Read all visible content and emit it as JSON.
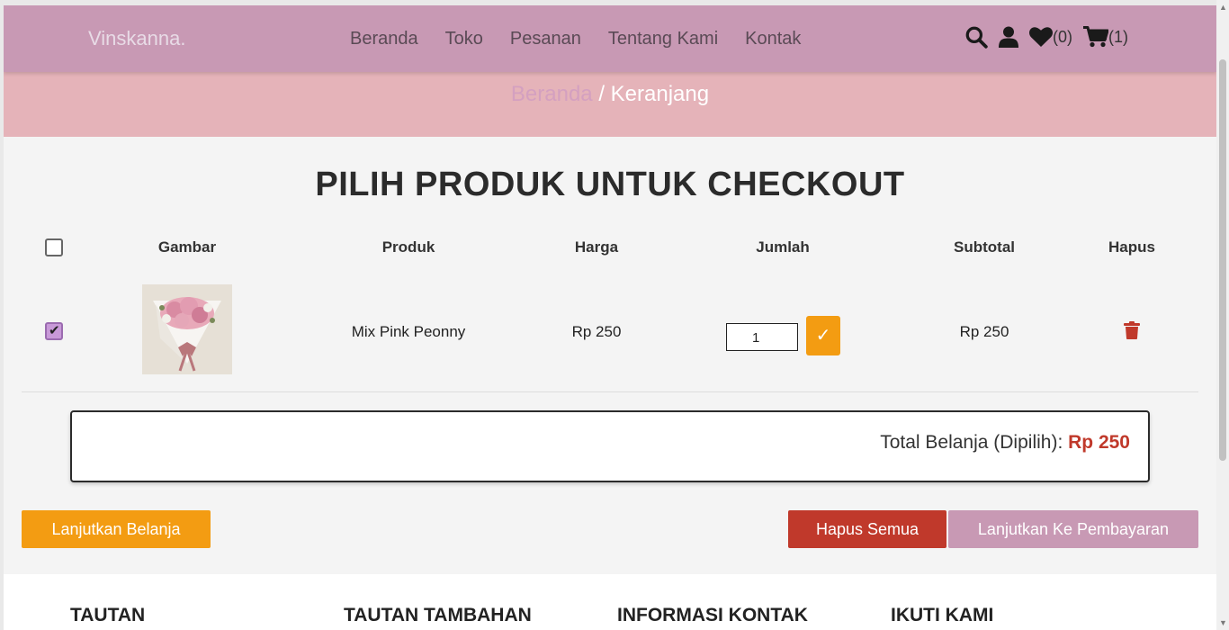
{
  "header": {
    "logo": "Vinskanna.",
    "nav": [
      "Beranda",
      "Toko",
      "Pesanan",
      "Tentang Kami",
      "Kontak"
    ],
    "wishlist_count": "(0)",
    "cart_count": "(1)"
  },
  "breadcrumb": {
    "home": "Beranda",
    "separator": " / ",
    "current": "Keranjang"
  },
  "page_title": "PILIH PRODUK UNTUK CHECKOUT",
  "table": {
    "headers": {
      "image": "Gambar",
      "product": "Produk",
      "price": "Harga",
      "quantity": "Jumlah",
      "subtotal": "Subtotal",
      "delete": "Hapus"
    },
    "rows": [
      {
        "checked": true,
        "product": "Mix Pink Peonny",
        "price": "Rp 250",
        "quantity": "1",
        "subtotal": "Rp 250"
      }
    ]
  },
  "total": {
    "label": "Total Belanja (Dipilih): ",
    "value": "Rp 250"
  },
  "buttons": {
    "continue_shopping": "Lanjutkan Belanja",
    "delete_all": "Hapus Semua",
    "checkout": "Lanjutkan Ke Pembayaran"
  },
  "footer": {
    "headings": [
      "TAUTAN",
      "TAUTAN TAMBAHAN",
      "INFORMASI KONTAK",
      "IKUTI KAMI"
    ]
  },
  "colors": {
    "header_bg": "#c899b4",
    "banner_bg": "#e5b3b9",
    "accent_orange": "#f39c12",
    "danger_red": "#c0392b"
  },
  "icons": [
    "search-icon",
    "user-icon",
    "heart-icon",
    "cart-icon",
    "trash-icon",
    "check-icon"
  ]
}
